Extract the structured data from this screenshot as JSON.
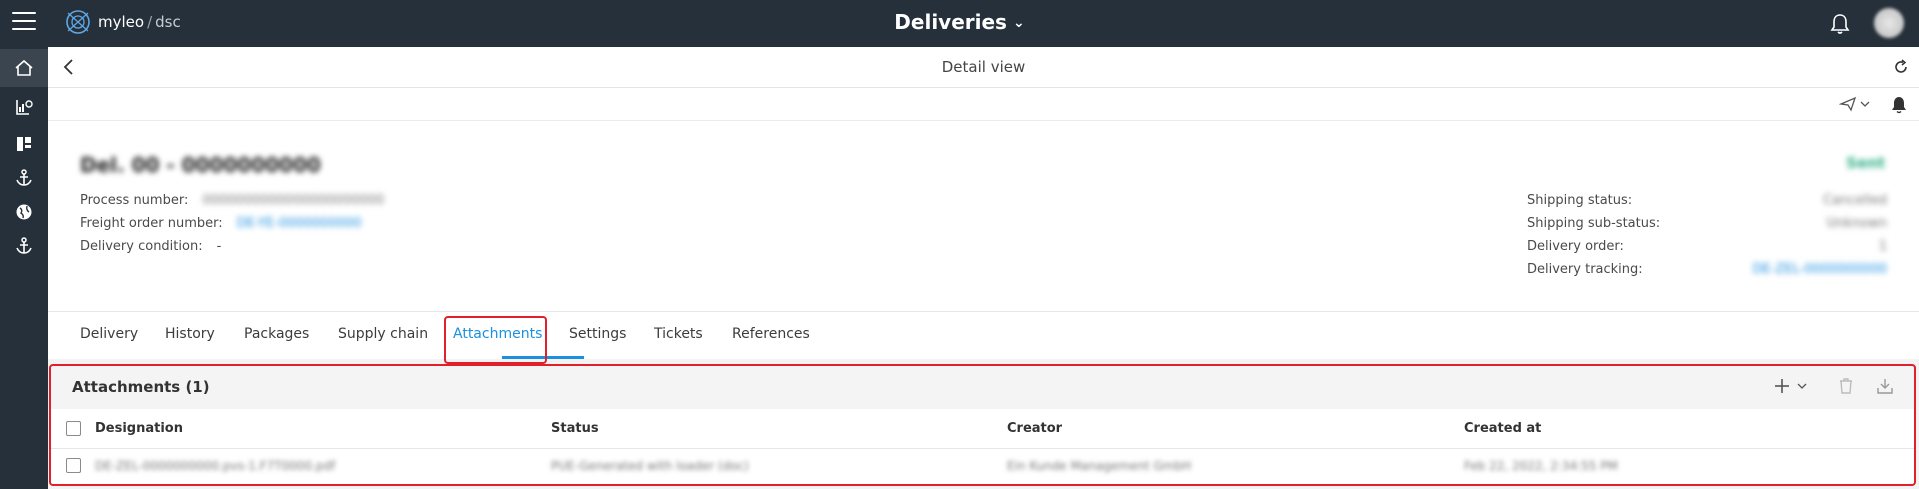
{
  "app": {
    "logo_name": "myleo",
    "logo_sub": "dsc",
    "title": "Deliveries"
  },
  "sidebar": {
    "items": [
      {
        "icon": "home-icon",
        "active": true
      },
      {
        "icon": "analytics-icon",
        "active": false
      },
      {
        "icon": "dashboard-icon",
        "active": false
      },
      {
        "icon": "anchor-icon",
        "active": false
      },
      {
        "icon": "globe-icon",
        "active": false
      },
      {
        "icon": "anchor-icon",
        "active": false
      }
    ]
  },
  "subheader": {
    "title": "Detail view"
  },
  "detail": {
    "heading": "Del. 00 - 0000000000",
    "status": "Sent",
    "process_number_label": "Process number:",
    "process_number_value": "0000000000000000000000",
    "freight_order_label": "Freight order number:",
    "freight_order_value": "DE-YE-0000000000",
    "delivery_condition_label": "Delivery condition:",
    "delivery_condition_value": "-",
    "shipping_status_label": "Shipping status:",
    "shipping_status_value": "Cancelled",
    "shipping_substatus_label": "Shipping sub-status:",
    "shipping_substatus_value": "Unknown",
    "delivery_order_label": "Delivery order:",
    "delivery_order_value": "1",
    "delivery_tracking_label": "Delivery tracking:",
    "delivery_tracking_value": "DE-ZEL-0000000000"
  },
  "tabs": [
    {
      "label": "Delivery"
    },
    {
      "label": "History"
    },
    {
      "label": "Packages"
    },
    {
      "label": "Supply chain"
    },
    {
      "label": "Attachments",
      "active": true
    },
    {
      "label": "Settings"
    },
    {
      "label": "Tickets"
    },
    {
      "label": "References"
    }
  ],
  "attachments": {
    "title": "Attachments (1)",
    "columns": [
      "Designation",
      "Status",
      "Creator",
      "Created at"
    ],
    "rows": [
      [
        "DE-ZEL-0000000000.pvs-1.F7T0000.pdf",
        "PUE-Generated with loader (doc)",
        "Ein Kunde Management GmbH",
        "Feb 22, 2022, 2:34:55 PM"
      ]
    ]
  },
  "colors": {
    "topbar": "#26303a",
    "accent": "#1b8fe0",
    "highlight": "#e0202a",
    "status": "#2fae86"
  }
}
